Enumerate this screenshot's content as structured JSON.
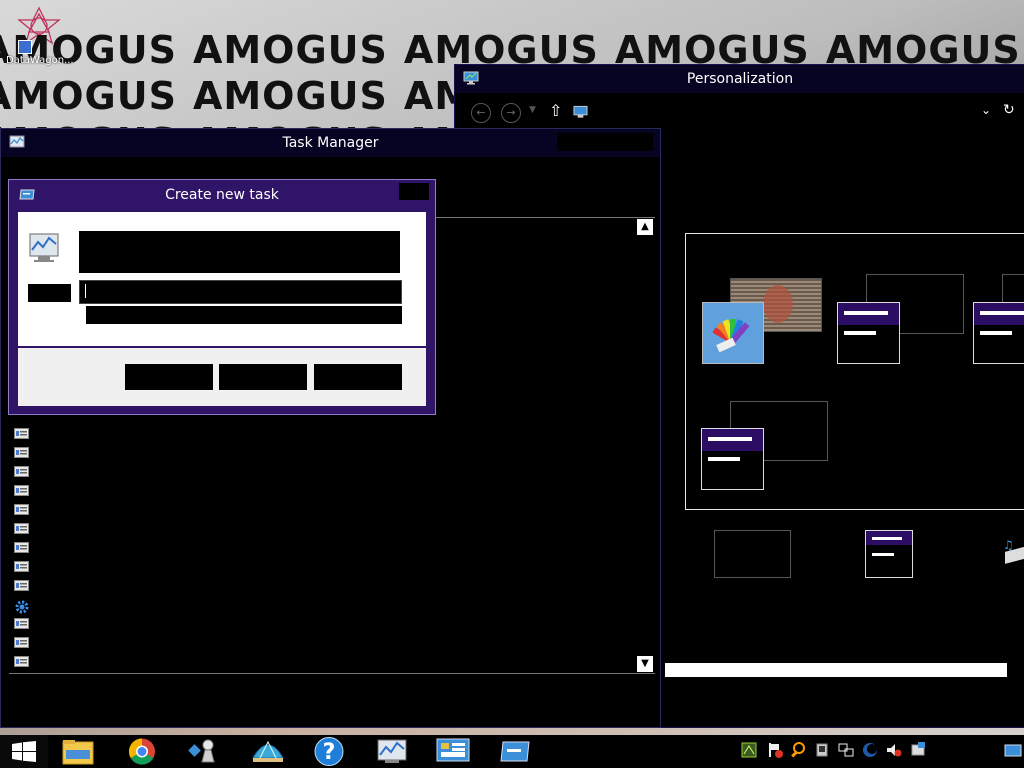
{
  "desktop": {
    "wallpaper_text": "AMOGUS",
    "shortcut_label": "DataWagon..."
  },
  "personalization": {
    "title": "Personalization"
  },
  "task_manager": {
    "title": "Task Manager"
  },
  "create_task_dialog": {
    "title": "Create new task"
  },
  "colors": {
    "title_bar": "#070322",
    "dialog_accent": "#2f1468",
    "theme_header": "#2b0e63",
    "window_bg": "#000000"
  },
  "taskbar": {
    "apps": [
      "file-explorer",
      "chrome",
      "game-piece",
      "shell-app",
      "help",
      "task-manager",
      "control-panel",
      "run-dialog"
    ]
  }
}
